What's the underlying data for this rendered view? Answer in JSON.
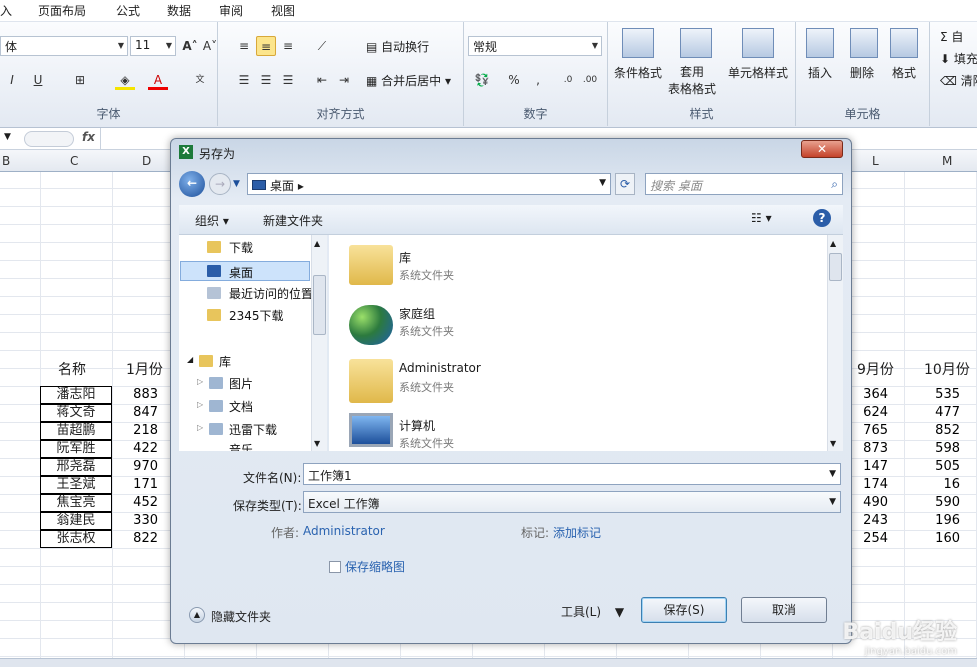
{
  "menu": [
    "入",
    "页面布局",
    "公式",
    "数据",
    "审阅",
    "视图"
  ],
  "ribbon": {
    "font_name": "体",
    "font_size": "11",
    "font_group": "字体",
    "align_group": "对齐方式",
    "number_group": "数字",
    "style_group": "样式",
    "cells_group": "单元格",
    "wrap_text": "自动换行",
    "merge_center": "合并后居中",
    "number_format": "常规",
    "cond_format": "条件格式",
    "table_format": "套用\n表格格式",
    "cell_style": "单元格样式",
    "insert": "插入",
    "delete": "删除",
    "format": "格式",
    "autosum": "自",
    "fill": "填充",
    "clear": "清除"
  },
  "formula": {
    "fx": "fx"
  },
  "col_headers": {
    "b": "B",
    "c": "C",
    "d": "D",
    "l": "L",
    "m": "M"
  },
  "table": {
    "headers": {
      "name": "名称",
      "m1": "1月份",
      "m9": "9月份",
      "m10": "10月份"
    },
    "rows": [
      {
        "name": "潘志阳",
        "m1": "883",
        "m9": "364",
        "m10": "535"
      },
      {
        "name": "蒋文奇",
        "m1": "847",
        "m9": "624",
        "m10": "477"
      },
      {
        "name": "苗超鹏",
        "m1": "218",
        "m9": "765",
        "m10": "852"
      },
      {
        "name": "阮军胜",
        "m1": "422",
        "m9": "873",
        "m10": "598"
      },
      {
        "name": "邢尧磊",
        "m1": "970",
        "m9": "147",
        "m10": "505"
      },
      {
        "name": "王圣斌",
        "m1": "171",
        "m9": "174",
        "m10": "16"
      },
      {
        "name": "焦宝亮",
        "m1": "452",
        "m9": "490",
        "m10": "590"
      },
      {
        "name": "翁建民",
        "m1": "330",
        "m9": "243",
        "m10": "196"
      },
      {
        "name": "张志权",
        "m1": "822",
        "m9": "254",
        "m10": "160"
      }
    ]
  },
  "dialog": {
    "title": "另存为",
    "path": "桌面",
    "search_placeholder": "搜索 桌面",
    "organize": "组织",
    "new_folder": "新建文件夹",
    "nav": {
      "downloads": "下载",
      "desktop": "桌面",
      "recent": "最近访问的位置",
      "dl2345": "2345下载",
      "libraries": "库",
      "pictures": "图片",
      "documents": "文档",
      "xunlei": "迅雷下载",
      "music": "音乐"
    },
    "files": [
      {
        "name": "库",
        "type": "系统文件夹"
      },
      {
        "name": "家庭组",
        "type": "系统文件夹"
      },
      {
        "name": "Administrator",
        "type": "系统文件夹"
      },
      {
        "name": "计算机",
        "type": "系统文件夹"
      }
    ],
    "filename_label": "文件名(N):",
    "filename": "工作簿1",
    "filetype_label": "保存类型(T):",
    "filetype": "Excel 工作簿",
    "author_label": "作者:",
    "author": "Administrator",
    "tags_label": "标记:",
    "tags": "添加标记",
    "thumbnail": "保存缩略图",
    "hide_folders": "隐藏文件夹",
    "tools": "工具(L)",
    "save": "保存(S)",
    "cancel": "取消"
  },
  "watermark": "Baidu经验",
  "watermark_url": "jingyan.baidu.com"
}
